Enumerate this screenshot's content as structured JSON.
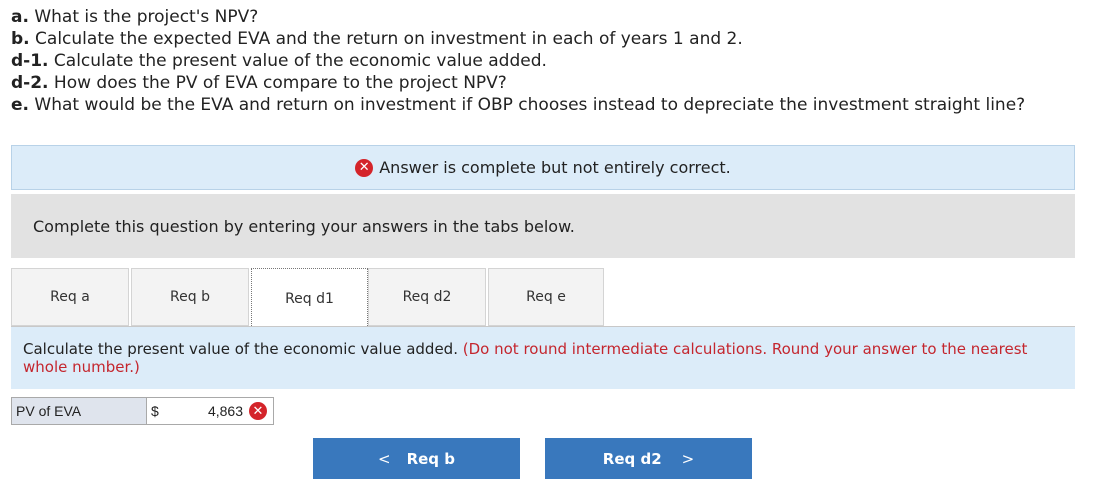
{
  "questions": [
    {
      "prefix": "a.",
      "text": " What is the project's NPV?"
    },
    {
      "prefix": "b.",
      "text": " Calculate the expected EVA and the return on investment in each of years 1 and 2."
    },
    {
      "prefix": "d-1.",
      "text": " Calculate the present value of the economic value added."
    },
    {
      "prefix": "d-2.",
      "text": " How does the PV of EVA compare to the project NPV?"
    },
    {
      "prefix": "e.",
      "text": " What would be the EVA and return on investment if OBP chooses instead to depreciate the investment straight line?"
    }
  ],
  "status_banner": {
    "icon": "x-circle-icon",
    "text": "Answer is complete but not entirely correct.",
    "color": "#d4242a"
  },
  "complete_prompt": "Complete this question by entering your answers in the tabs below.",
  "tabs": [
    {
      "label": "Req a",
      "active": false
    },
    {
      "label": "Req b",
      "active": false
    },
    {
      "label": "Req d1",
      "active": true
    },
    {
      "label": "Req d2",
      "active": false
    },
    {
      "label": "Req e",
      "active": false
    }
  ],
  "instruction": {
    "text": "Calculate the present value of the economic value added.",
    "note": "(Do not round intermediate calculations. Round your answer to the nearest whole number.)"
  },
  "answer_row": {
    "label": "PV of EVA",
    "currency": "$",
    "value": "4,863",
    "status_icon": "x-circle-icon"
  },
  "nav": {
    "prev_label": "Req b",
    "next_label": "Req d2",
    "prev_glyph": "<",
    "next_glyph": ">"
  },
  "colors": {
    "accent": "#3978bd",
    "error": "#d4242a",
    "banner": "#dcecf9"
  }
}
